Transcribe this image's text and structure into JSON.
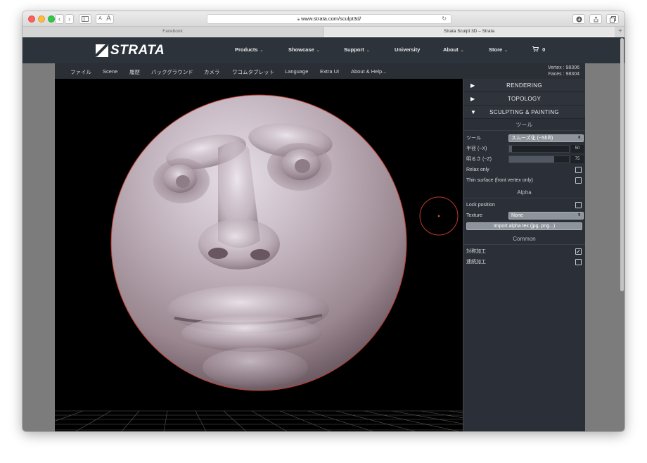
{
  "browser": {
    "url": "www.strata.com/sculpt3d/",
    "reader_small": "A",
    "reader_large": "A",
    "tabs": [
      {
        "label": "Facebook"
      },
      {
        "label": "Strata Sculpt 3D – Strata"
      }
    ],
    "new_tab": "+"
  },
  "site": {
    "logo_text": "STRATA",
    "nav": [
      {
        "label": "Products"
      },
      {
        "label": "Showcase"
      },
      {
        "label": "Support"
      },
      {
        "label": "University"
      },
      {
        "label": "About"
      },
      {
        "label": "Store"
      }
    ],
    "cart_count": "0",
    "colors": {
      "nav_bg": "#2d333b",
      "accent": "#c0392b"
    }
  },
  "app": {
    "menu": [
      {
        "label": "ファイル"
      },
      {
        "label": "Scene"
      },
      {
        "label": "履歴"
      },
      {
        "label": "バックグラウンド"
      },
      {
        "label": "カメラ"
      },
      {
        "label": "ワコムタブレット"
      },
      {
        "label": "Language"
      },
      {
        "label": "Extra UI"
      },
      {
        "label": "About & Help..."
      }
    ],
    "stats": {
      "vertex": "Vertex : 98306",
      "faces": "Faces : 98304"
    },
    "panel": {
      "sections": [
        {
          "label": "RENDERING",
          "expanded": false
        },
        {
          "label": "TOPOLOGY",
          "expanded": false
        },
        {
          "label": "SCULPTING & PAINTING",
          "expanded": true
        }
      ],
      "tools_header": "ツール",
      "tool_label": "ツール",
      "tool_value": "スムーズ化 (~Shift)",
      "radius_label": "半径 (~X)",
      "radius_value": "50",
      "radius_fraction": 0.05,
      "intensity_label": "明るさ (~Z)",
      "intensity_value": "75",
      "intensity_fraction": 0.75,
      "relax_label": "Relax only",
      "relax_checked": false,
      "thin_label": "Thin surface (front vertex only)",
      "thin_checked": false,
      "alpha_header": "Alpha",
      "lock_label": "Lock position",
      "lock_checked": false,
      "texture_label": "Texture",
      "texture_value": "None",
      "import_label": "Import alpha tex (jpg, png...)",
      "common_header": "Common",
      "symmetry_label": "対称加工",
      "symmetry_checked": true,
      "continuous_label": "連続加工",
      "continuous_checked": false
    }
  }
}
